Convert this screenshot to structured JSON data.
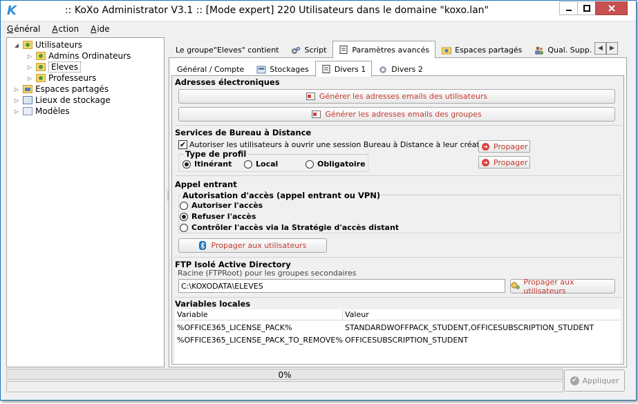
{
  "window": {
    "title": ":: KoXo Administrator V3.1 :: [Mode expert] 220 Utilisateurs dans le domaine \"koxo.lan\"",
    "app_icon": "K"
  },
  "menu": [
    {
      "label": "Général",
      "mnemonic_index": 0
    },
    {
      "label": "Action",
      "mnemonic_index": 0
    },
    {
      "label": "Aide",
      "mnemonic_index": 0
    }
  ],
  "tree": {
    "root": {
      "label": "Utilisateurs",
      "icon": "users-folder-icon"
    },
    "children": [
      {
        "label": "Admins Ordinateurs",
        "icon": "users-folder-icon"
      },
      {
        "label": "Eleves",
        "icon": "users-folder-icon",
        "selected": true
      },
      {
        "label": "Professeurs",
        "icon": "users-folder-icon"
      }
    ],
    "others": [
      {
        "label": "Espaces partagés",
        "icon": "share-folder-icon"
      },
      {
        "label": "Lieux de stockage",
        "icon": "storage-icon"
      },
      {
        "label": "Modèles",
        "icon": "templates-icon"
      }
    ]
  },
  "tabs_top": [
    {
      "label": "Le groupe\"Eleves\" contient",
      "icon": ""
    },
    {
      "label": "Script",
      "icon": "gears-icon"
    },
    {
      "label": "Paramètres avancés",
      "icon": "document-icon",
      "active": true
    },
    {
      "label": "Espaces partagés",
      "icon": "share-icon"
    },
    {
      "label": "Qual. Supp.",
      "icon": "users-icon"
    }
  ],
  "tabs_sub": [
    {
      "label": "Général / Compte",
      "icon": ""
    },
    {
      "label": "Stockages",
      "icon": "storage-icon"
    },
    {
      "label": "Divers 1",
      "icon": "document-icon",
      "active": true
    },
    {
      "label": "Divers 2",
      "icon": "gear-icon"
    }
  ],
  "email": {
    "title": "Adresses électroniques",
    "btn_users": "Générer les adresses emails des utilisateurs",
    "btn_groups": "Générer les adresses emails des groupes"
  },
  "rds": {
    "title": "Services de Bureau à Distance",
    "allow_label": "Autoriser les utilisateurs à ouvrir une session Bureau à Distance à leur création",
    "allow_checked": true,
    "propagate_label": "Propager",
    "profile_title": "Type de profil",
    "profile_options": [
      "Itinérant",
      "Local",
      "Obligatoire"
    ],
    "profile_selected": "Itinérant"
  },
  "dialin": {
    "title": "Appel entrant",
    "group_title": "Autorisation d'accès (appel entrant ou VPN)",
    "options": [
      "Autoriser l'accès",
      "Refuser l'accès",
      "Contrôler l'accès via la Stratégie d'accès distant"
    ],
    "selected": "Refuser l'accès",
    "propagate_label": "Propager aux utilisateurs"
  },
  "ftp": {
    "title": "FTP Isolé Active Directory",
    "subtitle": "Racine (FTPRoot) pour les groupes secondaires",
    "value": "C:\\KOXODATA\\ELEVES",
    "propagate_label": "Propager aux utilisateurs"
  },
  "locals": {
    "title": "Variables locales",
    "columns": [
      "Variable",
      "Valeur"
    ],
    "rows": [
      [
        "%OFFICE365_LICENSE_PACK%",
        "STANDARDWOFFPACK_STUDENT,OFFICESUBSCRIPTION_STUDENT"
      ],
      [
        "%OFFICE365_LICENSE_PACK_TO_REMOVE%",
        "OFFICESUBSCRIPTION_STUDENT"
      ]
    ]
  },
  "status": {
    "progress_text": "0%",
    "progress_fraction": 0,
    "apply_label": "Appliquer",
    "apply_enabled": false
  },
  "colors": {
    "action_text": "#c3392f",
    "close_button": "#c75050",
    "progress_fill": "#06b025"
  }
}
